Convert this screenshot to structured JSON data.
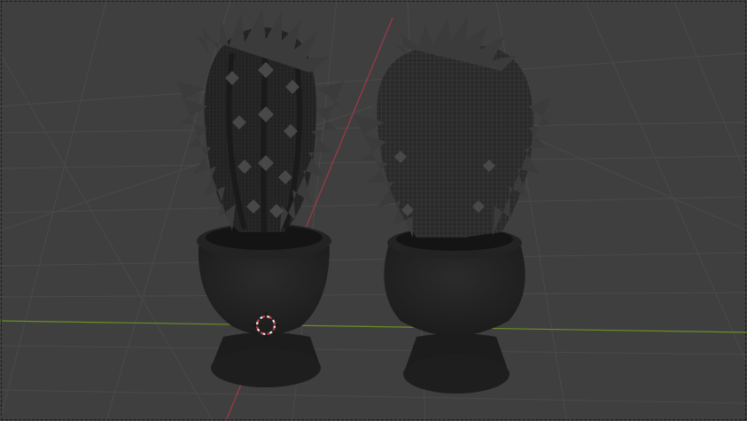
{
  "app": {
    "name": "3D viewport",
    "view": "perspective"
  },
  "scene": {
    "objects": [
      {
        "name": "cactus-left",
        "type": "mesh",
        "display": "wireframe"
      },
      {
        "name": "cactus-right",
        "type": "mesh",
        "display": "wireframe"
      }
    ],
    "cursor": {
      "name": "3d-cursor"
    },
    "axes": {
      "x_color": "#b8384a",
      "y_color": "#6b8e23"
    },
    "colors": {
      "background": "#3f3f3f",
      "grid": "#4a4a4a",
      "mesh_dark": "#262626",
      "mesh_mid": "#313131",
      "spike": "#3e3e3e"
    }
  }
}
